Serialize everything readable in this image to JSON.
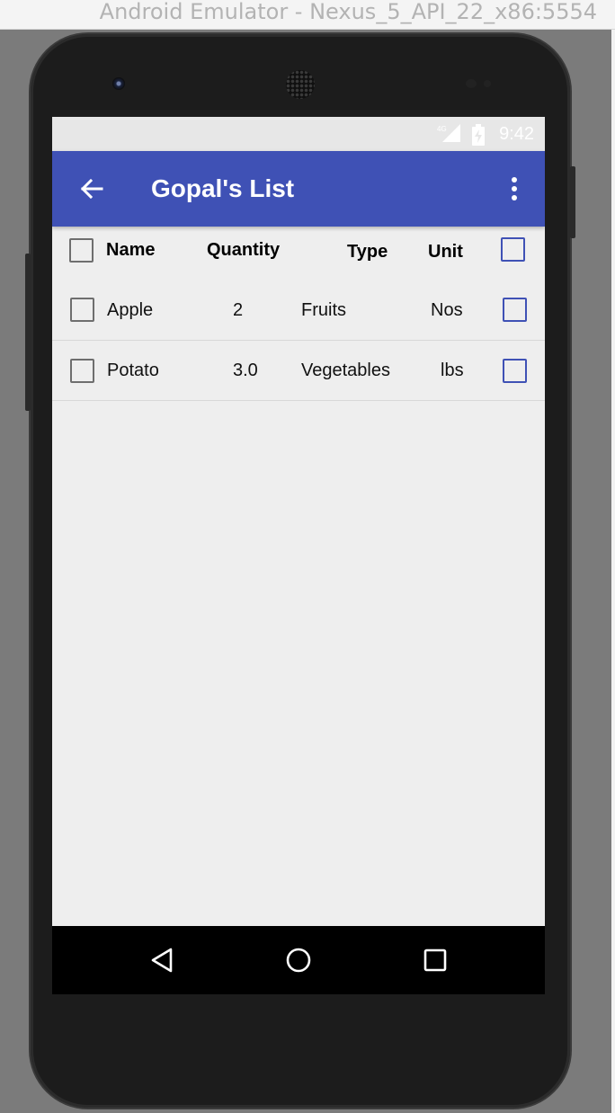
{
  "window": {
    "title": "Android Emulator - Nexus_5_API_22_x86:5554"
  },
  "status_bar": {
    "time": "9:42",
    "network_icon": "signal-4g-icon",
    "battery_icon": "battery-charging-icon"
  },
  "app_bar": {
    "title": "Gopal's List",
    "back_icon": "arrow-back-icon",
    "overflow_icon": "more-vertical-icon"
  },
  "table": {
    "columns": [
      "Name",
      "Quantity",
      "Type",
      "Unit"
    ],
    "header_select_all_left": false,
    "header_select_all_right": false,
    "rows": [
      {
        "name": "Apple",
        "quantity": "2",
        "type": "Fruits",
        "unit": "Nos",
        "checked_left": false,
        "checked_right": false
      },
      {
        "name": "Potato",
        "quantity": "3.0",
        "type": "Vegetables",
        "unit": "lbs",
        "checked_left": false,
        "checked_right": false
      }
    ]
  },
  "nav_bar": {
    "back_icon": "triangle-back-icon",
    "home_icon": "circle-home-icon",
    "recents_icon": "square-recents-icon"
  },
  "colors": {
    "primary": "#3f51b5",
    "background": "#eeeeee",
    "nav": "#000000"
  }
}
